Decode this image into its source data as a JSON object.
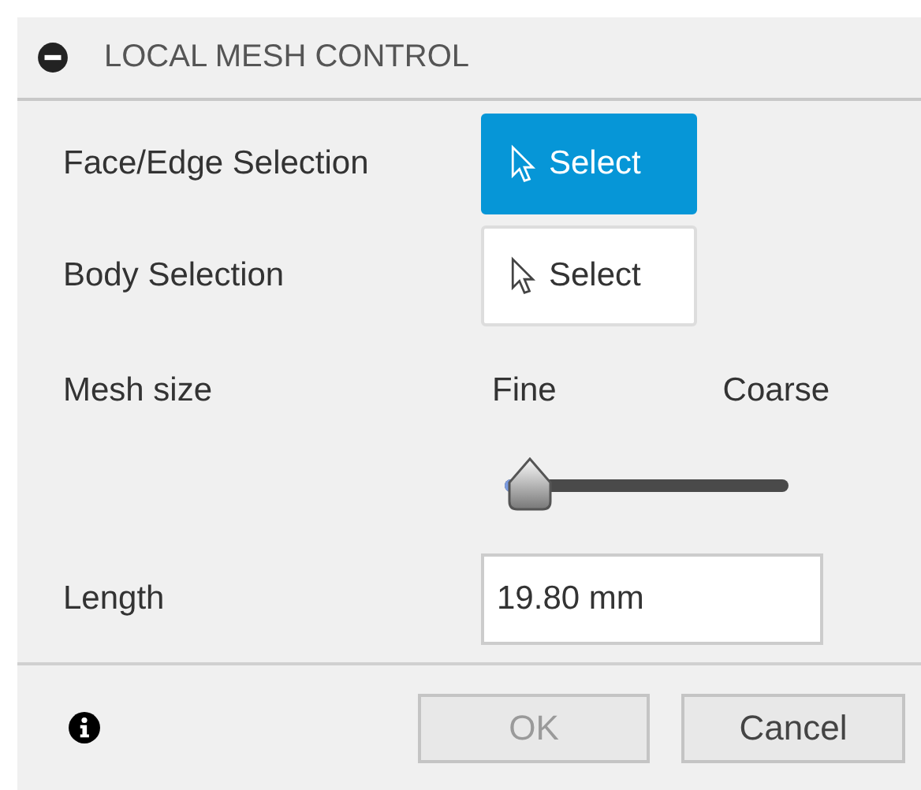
{
  "panel": {
    "title": "LOCAL MESH CONTROL",
    "expanded": true
  },
  "selections": [
    {
      "label": "Face/Edge Selection",
      "button": "Select",
      "selected": true
    },
    {
      "label": "Body Selection",
      "button": "Select",
      "selected": false
    }
  ],
  "mesh_size": {
    "label": "Mesh size",
    "min_label": "Fine",
    "max_label": "Coarse",
    "level": 0.08
  },
  "length": {
    "label": "Length",
    "value": "19.80 mm"
  },
  "buttons": [
    {
      "label": "OK",
      "disabled": true
    },
    {
      "label": "Cancel",
      "disabled": false
    }
  ]
}
